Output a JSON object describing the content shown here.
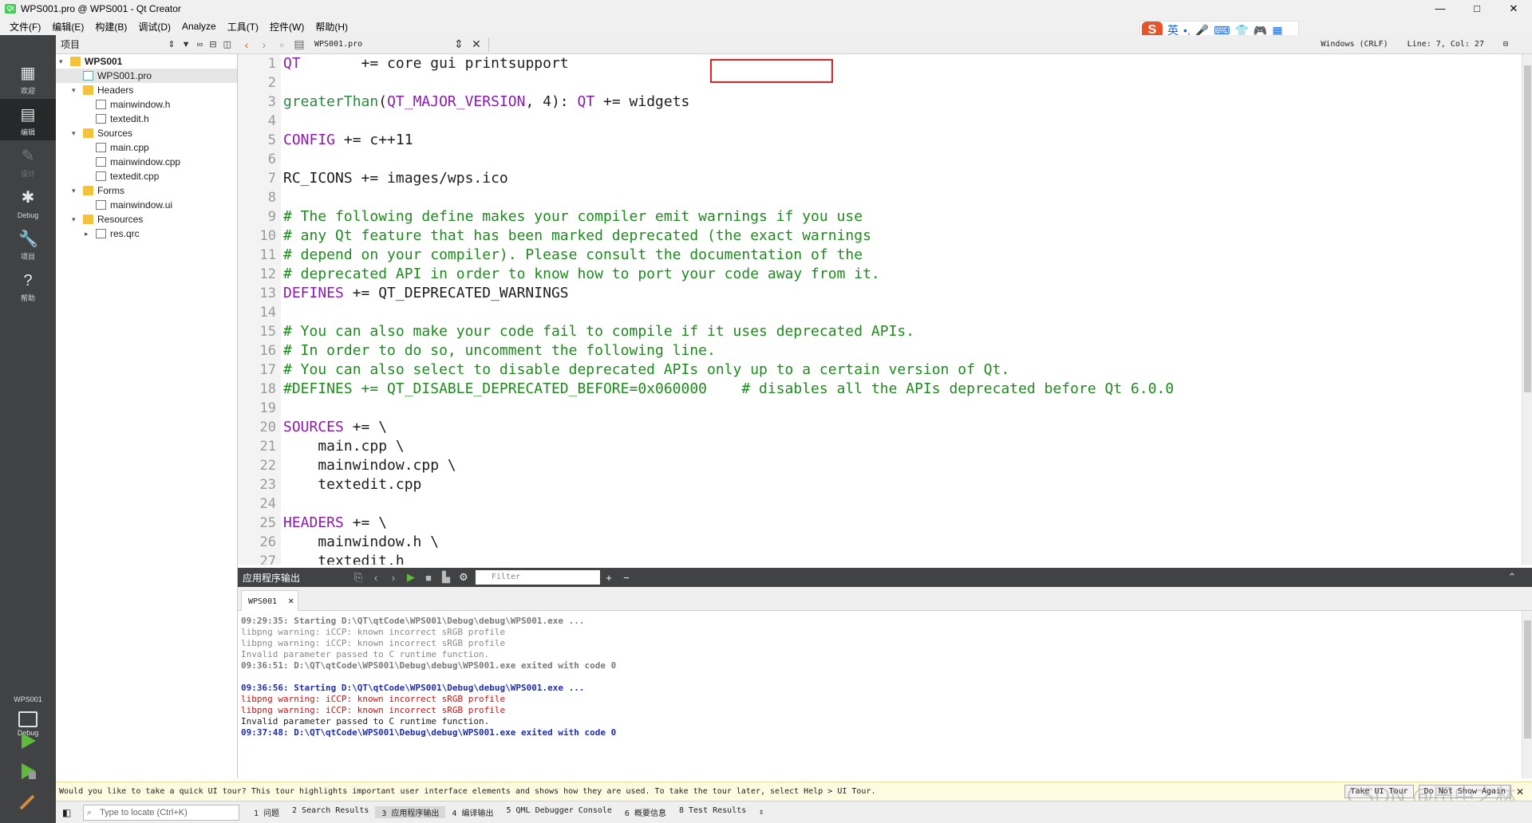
{
  "window": {
    "title": "WPS001.pro @ WPS001 - Qt Creator",
    "minimize": "—",
    "maximize": "□",
    "close": "✕"
  },
  "ime": {
    "lang": "英",
    "extras": [
      "•,",
      "🎤",
      "⌨",
      "👕",
      "🎮",
      "▦"
    ]
  },
  "menu": [
    "文件(F)",
    "编辑(E)",
    "构建(B)",
    "调试(D)",
    "Analyze",
    "工具(T)",
    "控件(W)",
    "帮助(H)"
  ],
  "modes": [
    {
      "label": "欢迎",
      "icon": "grid-icon"
    },
    {
      "label": "编辑",
      "icon": "edit-icon"
    },
    {
      "label": "设计",
      "icon": "pencil-icon"
    },
    {
      "label": "Debug",
      "icon": "bug-icon"
    },
    {
      "label": "项目",
      "icon": "wrench-icon"
    },
    {
      "label": "帮助",
      "icon": "help-icon"
    }
  ],
  "kit": {
    "project": "WPS001",
    "config": "Debug"
  },
  "project_panel": {
    "title": "项目",
    "tree": [
      {
        "text": "WPS001",
        "level": 0,
        "type": "project",
        "expanded": true,
        "bold": true
      },
      {
        "text": "WPS001.pro",
        "level": 1,
        "type": "pro",
        "selected": true
      },
      {
        "text": "Headers",
        "level": 1,
        "type": "folder",
        "expanded": true
      },
      {
        "text": "mainwindow.h",
        "level": 2,
        "type": "file"
      },
      {
        "text": "textedit.h",
        "level": 2,
        "type": "file"
      },
      {
        "text": "Sources",
        "level": 1,
        "type": "folder",
        "expanded": true
      },
      {
        "text": "main.cpp",
        "level": 2,
        "type": "file"
      },
      {
        "text": "mainwindow.cpp",
        "level": 2,
        "type": "file"
      },
      {
        "text": "textedit.cpp",
        "level": 2,
        "type": "file"
      },
      {
        "text": "Forms",
        "level": 1,
        "type": "folder",
        "expanded": true
      },
      {
        "text": "mainwindow.ui",
        "level": 2,
        "type": "file"
      },
      {
        "text": "Resources",
        "level": 1,
        "type": "folder",
        "expanded": true
      },
      {
        "text": "res.qrc",
        "level": 2,
        "type": "file",
        "collapsed": true
      }
    ]
  },
  "editor": {
    "document": "WPS001.pro",
    "line_ending": "Windows (CRLF)",
    "position": "Line: 7, Col: 27",
    "lines": [
      [
        [
          "kw",
          "QT"
        ],
        [
          "plain",
          "       += core gui "
        ],
        [
          "plain",
          "printsupport"
        ]
      ],
      [],
      [
        [
          "fn",
          "greaterThan"
        ],
        [
          "plain",
          "("
        ],
        [
          "kw",
          "QT_MAJOR_VERSION"
        ],
        [
          "plain",
          ", 4): "
        ],
        [
          "kw",
          "QT"
        ],
        [
          "plain",
          " += widgets"
        ]
      ],
      [],
      [
        [
          "kw",
          "CONFIG"
        ],
        [
          "plain",
          " += c++11"
        ]
      ],
      [],
      [
        [
          "plain",
          "RC_ICONS += images/wps.ico"
        ]
      ],
      [],
      [
        [
          "cm",
          "# The following define makes your compiler emit warnings if you use"
        ]
      ],
      [
        [
          "cm",
          "# any Qt feature that has been marked deprecated (the exact warnings"
        ]
      ],
      [
        [
          "cm",
          "# depend on your compiler). Please consult the documentation of the"
        ]
      ],
      [
        [
          "cm",
          "# deprecated API in order to know how to port your code away from it."
        ]
      ],
      [
        [
          "kw",
          "DEFINES"
        ],
        [
          "plain",
          " += QT_DEPRECATED_WARNINGS"
        ]
      ],
      [],
      [
        [
          "cm",
          "# You can also make your code fail to compile if it uses deprecated APIs."
        ]
      ],
      [
        [
          "cm",
          "# In order to do so, uncomment the following line."
        ]
      ],
      [
        [
          "cm",
          "# You can also select to disable deprecated APIs only up to a certain version of Qt."
        ]
      ],
      [
        [
          "cm",
          "#DEFINES += QT_DISABLE_DEPRECATED_BEFORE=0x060000    # disables all the APIs deprecated before Qt 6.0.0"
        ]
      ],
      [],
      [
        [
          "kw",
          "SOURCES"
        ],
        [
          "plain",
          " += \\"
        ]
      ],
      [
        [
          "plain",
          "    main.cpp \\"
        ]
      ],
      [
        [
          "plain",
          "    mainwindow.cpp \\"
        ]
      ],
      [
        [
          "plain",
          "    textedit.cpp"
        ]
      ],
      [],
      [
        [
          "kw",
          "HEADERS"
        ],
        [
          "plain",
          " += \\"
        ]
      ],
      [
        [
          "plain",
          "    mainwindow.h \\"
        ]
      ],
      [
        [
          "plain",
          "    textedit.h"
        ]
      ]
    ]
  },
  "output": {
    "title": "应用程序输出",
    "filter_placeholder": "Filter",
    "tab": "WPS001",
    "lines": [
      {
        "style": "o-gray-b",
        "text": "09:29:35: Starting D:\\QT\\qtCode\\WPS001\\Debug\\debug\\WPS001.exe ..."
      },
      {
        "style": "o-gray",
        "text": "libpng warning: iCCP: known incorrect sRGB profile"
      },
      {
        "style": "o-gray",
        "text": "libpng warning: iCCP: known incorrect sRGB profile"
      },
      {
        "style": "o-gray",
        "text": "Invalid parameter passed to C runtime function."
      },
      {
        "style": "o-gray-b",
        "text": "09:36:51: D:\\QT\\qtCode\\WPS001\\Debug\\debug\\WPS001.exe exited with code 0"
      },
      {
        "style": "o-black",
        "text": ""
      },
      {
        "style": "o-blue",
        "text": "09:36:56: Starting D:\\QT\\qtCode\\WPS001\\Debug\\debug\\WPS001.exe ..."
      },
      {
        "style": "o-red",
        "text": "libpng warning: iCCP: known incorrect sRGB profile"
      },
      {
        "style": "o-red",
        "text": "libpng warning: iCCP: known incorrect sRGB profile"
      },
      {
        "style": "o-black",
        "text": "Invalid parameter passed to C runtime function."
      },
      {
        "style": "o-blue",
        "text": "09:37:48: D:\\QT\\qtCode\\WPS001\\Debug\\debug\\WPS001.exe exited with code 0"
      }
    ]
  },
  "infobar": {
    "message": "Would you like to take a quick UI tour? This tour highlights important user interface elements and shows how they are used. To take the tour later, select Help > UI Tour.",
    "take_tour": "Take UI Tour",
    "dont_show": "Do Not Show Again"
  },
  "watermark": "CSDN @田中之林",
  "statusbar": {
    "locate_placeholder": "Type to locate (Ctrl+K)",
    "tabs": [
      "1 问题",
      "2 Search Results",
      "3 应用程序输出",
      "4 编译输出",
      "5 QML Debugger Console",
      "6 概要信息",
      "8 Test Results"
    ]
  }
}
